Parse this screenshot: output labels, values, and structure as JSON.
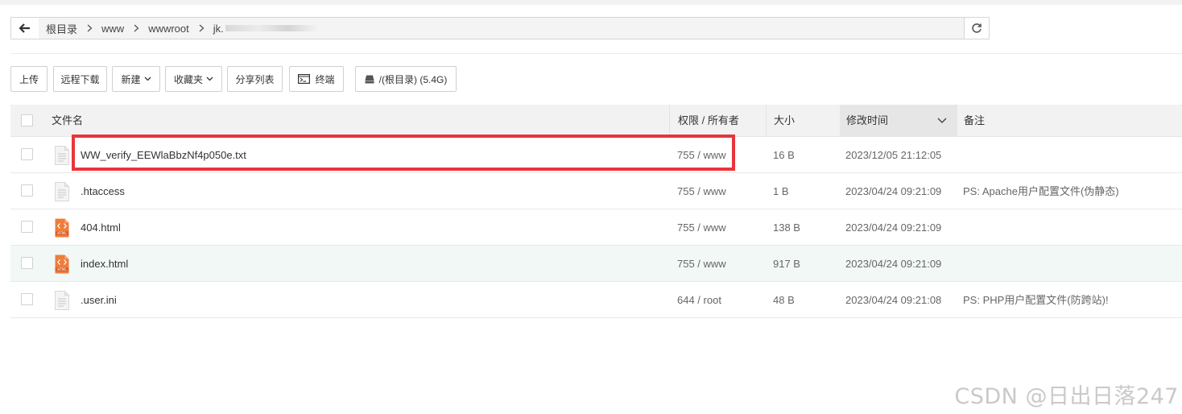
{
  "breadcrumb": {
    "items": [
      "根目录",
      "www",
      "wwwroot",
      "jk."
    ]
  },
  "toolbar": {
    "upload": "上传",
    "remote_download": "远程下载",
    "new": "新建",
    "favorites": "收藏夹",
    "share_list": "分享列表",
    "terminal": "终端",
    "disk": "/(根目录) (5.4G)"
  },
  "table": {
    "headers": {
      "name": "文件名",
      "perm": "权限 / 所有者",
      "size": "大小",
      "mtime": "修改时间",
      "remark": "备注"
    },
    "rows": [
      {
        "name": "WW_verify_EEWlaBbzNf4p050e.txt",
        "perm": "755 / www",
        "size": "16 B",
        "mtime": "2023/12/05 21:12:05",
        "remark": "",
        "icon": "text-file-icon"
      },
      {
        "name": ".htaccess",
        "perm": "755 / www",
        "size": "1 B",
        "mtime": "2023/04/24 09:21:09",
        "remark": "PS: Apache用户配置文件(伪静态)",
        "icon": "text-file-icon"
      },
      {
        "name": "404.html",
        "perm": "755 / www",
        "size": "138 B",
        "mtime": "2023/04/24 09:21:09",
        "remark": "",
        "icon": "html-file-icon"
      },
      {
        "name": "index.html",
        "perm": "755 / www",
        "size": "917 B",
        "mtime": "2023/04/24 09:21:09",
        "remark": "",
        "icon": "html-file-icon"
      },
      {
        "name": ".user.ini",
        "perm": "644 / root",
        "size": "48 B",
        "mtime": "2023/04/24 09:21:08",
        "remark": "PS: PHP用户配置文件(防跨站)!",
        "icon": "text-file-icon"
      }
    ]
  },
  "watermark": "CSDN @日出日落247",
  "colors": {
    "highlight_box": "#e8353b",
    "row_hover": "#f2f8f6",
    "html_icon": "#f07c3a"
  }
}
